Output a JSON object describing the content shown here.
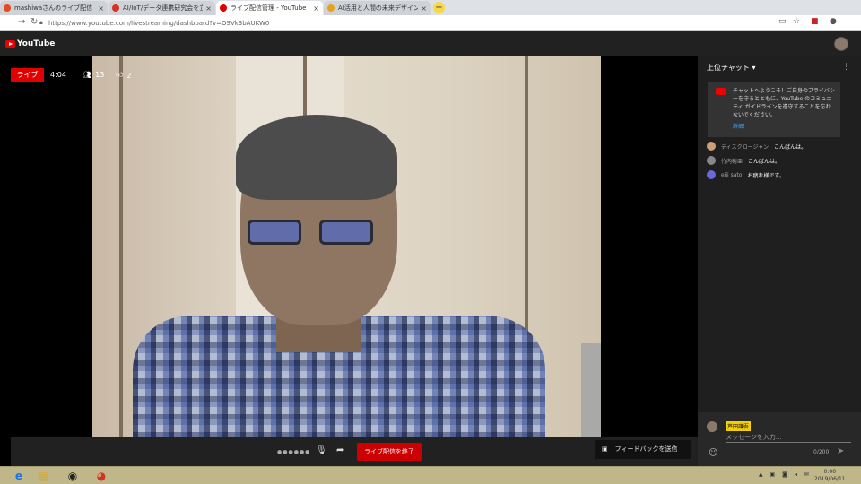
{
  "browser": {
    "tabs": [
      {
        "title": "mashiwaさんのライブ配信",
        "fav_color": "#e84a1e"
      },
      {
        "title": "AI/IoT/データ連携研究会を立ち上げて",
        "fav_color": "#d93025"
      },
      {
        "title": "ライブ配信管理 - YouTube",
        "fav_color": "#e00000"
      },
      {
        "title": "AI活用と人間の未来デザインにつ",
        "fav_color": "#e8a21e"
      }
    ],
    "new_tab": "+",
    "url": "https://www.youtube.com/livestreaming/dashboard?v=O9Vk3bAUKW0"
  },
  "youtube": {
    "logo_text": "YouTube"
  },
  "player": {
    "live_label": "ライブ",
    "elapsed": "4:04",
    "viewer_count": "13",
    "like_count": "2",
    "end_stream_label": "ライブ配信を終了",
    "feedback_label": "フィードバックを送信"
  },
  "chat": {
    "header": "上位チャット ▾",
    "notice_text": "チャットへようこそ！ご自身のプライバシーを守るとともに、YouTube のコミュニティ ガイドラインを遵守することを忘れないでください。",
    "notice_link": "詳細",
    "messages": [
      {
        "author": "ディスクロージャン",
        "text": "こんばんは。",
        "color": "#c9a07a"
      },
      {
        "author": "竹内裕亜",
        "text": "こんばんは。",
        "color": "#888888"
      },
      {
        "author": "eiji sato",
        "text": "お疲れ様です。",
        "color": "#6a6adb"
      }
    ],
    "current_user": "芦田謙吾",
    "input_placeholder": "メッセージを入力...",
    "char_count": "0/200"
  },
  "taskbar": {
    "time": "0:00",
    "date": "2019/06/11"
  }
}
